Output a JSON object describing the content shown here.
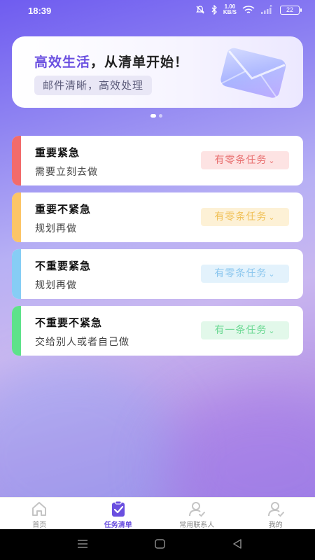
{
  "status_bar": {
    "time": "18:39",
    "net_speed_value": "1.00",
    "net_speed_unit": "KB/S",
    "battery": "22"
  },
  "banner": {
    "title_highlight": "高效生活",
    "title_rest": "，从清单开始！",
    "subtitle": "邮件清晰，高效处理",
    "icon": "envelope-icon"
  },
  "tasks": [
    {
      "title": "重要紧急",
      "desc": "需要立刻去做",
      "badge": "有零条任务",
      "accent": "#f26b6b",
      "badge_bg": "#fde3e3",
      "badge_color": "#e86f6f"
    },
    {
      "title": "重要不紧急",
      "desc": "规划再做",
      "badge": "有零条任务",
      "accent": "#fcc567",
      "badge_bg": "#fdf1d6",
      "badge_color": "#f0c056"
    },
    {
      "title": "不重要紧急",
      "desc": "规划再做",
      "badge": "有零条任务",
      "accent": "#86cdf5",
      "badge_bg": "#e3f2fc",
      "badge_color": "#8ac6ee"
    },
    {
      "title": "不重要不紧急",
      "desc": "交给别人或者自己做",
      "badge": "有一条任务",
      "accent": "#5ee28a",
      "badge_bg": "#e2f8ea",
      "badge_color": "#6ad892"
    }
  ],
  "tabbar": {
    "tabs": [
      {
        "label": "首页",
        "icon": "home-icon",
        "active": false
      },
      {
        "label": "任务清单",
        "icon": "clipboard-check-icon",
        "active": true
      },
      {
        "label": "常用联系人",
        "icon": "contact-icon",
        "active": false
      },
      {
        "label": "我的",
        "icon": "profile-icon",
        "active": false
      }
    ]
  },
  "colors": {
    "accent": "#6a4fe0"
  }
}
